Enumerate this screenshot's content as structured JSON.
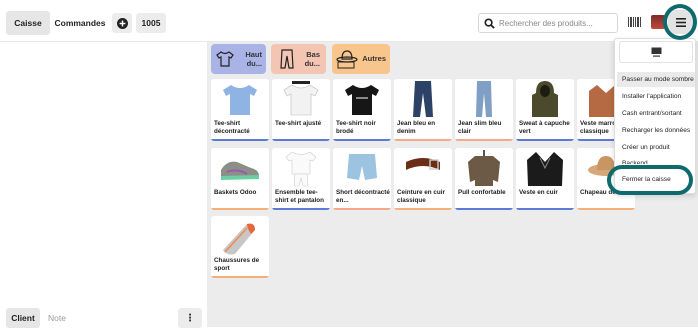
{
  "topbar": {
    "tab_caisse": "Caisse",
    "tab_commandes": "Commandes",
    "order_number": "1005",
    "search_placeholder": "Rechercher des produits..."
  },
  "left": {
    "client_label": "Client",
    "note_label": "Note",
    "more_label": "⋮"
  },
  "categories": [
    {
      "label_line1": "Haut",
      "label_line2": "du...",
      "color": "#a9b3e6",
      "icon": "tshirt-icon"
    },
    {
      "label_line1": "Bas",
      "label_line2": "du...",
      "color": "#f5c5b4",
      "icon": "pants-icon"
    },
    {
      "label_line1": "Autres",
      "label_line2": "",
      "color": "#f8c58c",
      "icon": "hat-icon"
    }
  ],
  "products": [
    {
      "name": "Tee-shirt décontracté",
      "bar": "#5b7bd5",
      "icon": "tshirt-blue"
    },
    {
      "name": "Tee-shirt ajusté",
      "bar": "#5b7bd5",
      "icon": "tshirt-white"
    },
    {
      "name": "Tee-shirt noir brodé",
      "bar": "#5b7bd5",
      "icon": "tshirt-black"
    },
    {
      "name": "Jean bleu en denim",
      "bar": "#f3a98a",
      "icon": "jeans"
    },
    {
      "name": "Jean slim bleu clair",
      "bar": "#f3a98a",
      "icon": "jeans-light"
    },
    {
      "name": "Sweat à capuche vert",
      "bar": "#5b7bd5",
      "icon": "hoodie"
    },
    {
      "name": "Veste marro classique",
      "bar": "#5b7bd5",
      "icon": "jacket"
    },
    {
      "name": "Baskets Odoo",
      "bar": "#f3b07a",
      "icon": "sneakers"
    },
    {
      "name": "Ensemble tee-shirt et pantalon",
      "bar": "#5b7bd5",
      "icon": "set"
    },
    {
      "name": "Short décontracté en...",
      "bar": "#f3a98a",
      "icon": "shorts"
    },
    {
      "name": "Ceinture en cuir classique",
      "bar": "#f3b07a",
      "icon": "belt"
    },
    {
      "name": "Pull confortable",
      "bar": "#5b7bd5",
      "icon": "sweater"
    },
    {
      "name": "Veste en cuir",
      "bar": "#5b7bd5",
      "icon": "leather-jacket"
    },
    {
      "name": "Chapeau de soleil",
      "bar": "#f3b07a",
      "icon": "sunhat"
    },
    {
      "name": "",
      "bar": "#5b7bd5",
      "icon": "blank"
    },
    {
      "name": "Chaussures de sport",
      "bar": "#f3b07a",
      "icon": "running-shoe"
    }
  ],
  "menu": {
    "items": [
      "Passer au mode sombre",
      "Installer l'application",
      "Cash entrant/sortant",
      "Recharger les données",
      "Créer un produit",
      "Backend",
      "Fermer la caisse"
    ]
  }
}
